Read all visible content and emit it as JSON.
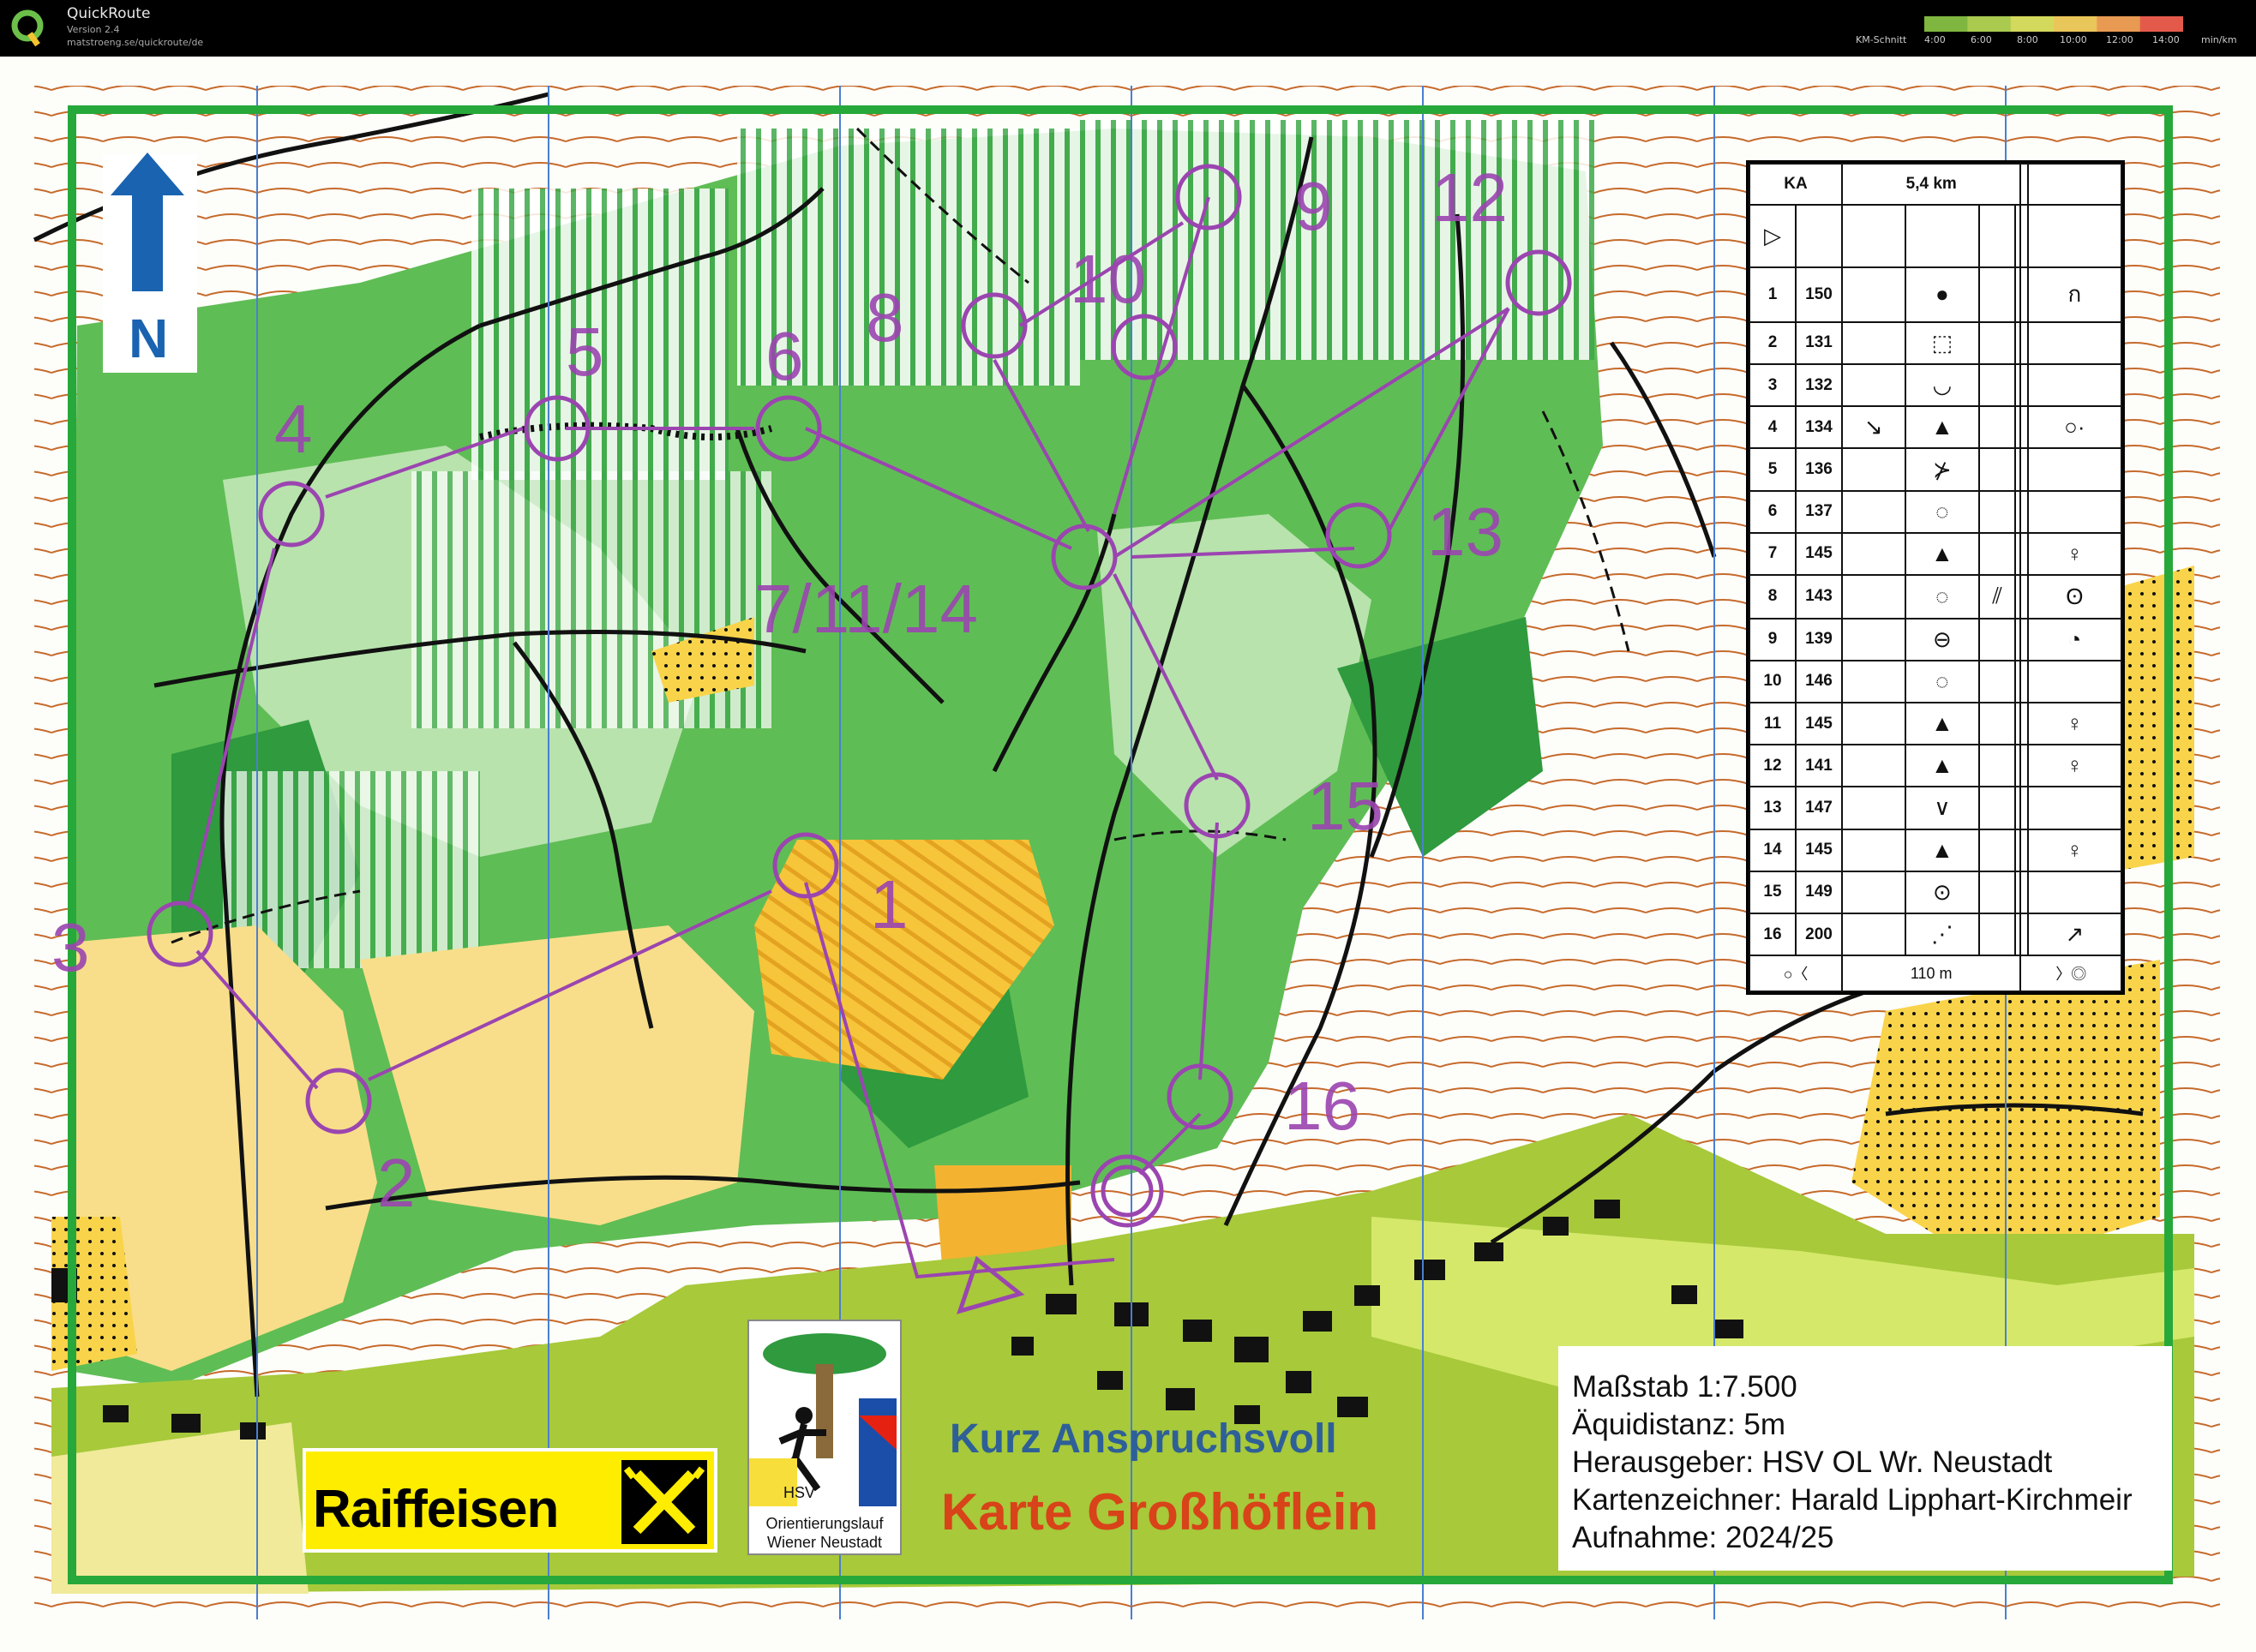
{
  "app": {
    "name": "QuickRoute",
    "version": "Version 2.4",
    "url": "matstroeng.se/quickroute/de"
  },
  "pace_scale": {
    "label": "KM-Schnitt",
    "ticks": [
      "4:00",
      "6:00",
      "8:00",
      "10:00",
      "12:00",
      "14:00"
    ],
    "unit": "min/km",
    "colors": [
      "#7fb640",
      "#a9c94f",
      "#d3d95c",
      "#e9c659",
      "#e99a52",
      "#e45a4a"
    ]
  },
  "map": {
    "north_label": "N",
    "course_color": "#9b45b0",
    "controls": [
      "1",
      "2",
      "3",
      "4",
      "5",
      "6",
      "7/11/14",
      "8",
      "9",
      "10",
      "12",
      "13",
      "15",
      "16"
    ],
    "course_name": "Kurz Anspruchsvoll",
    "map_name": "Karte Großhöflein"
  },
  "legend": {
    "header": [
      "KA",
      "5,4 km"
    ],
    "start_symbol": "▷",
    "rows": [
      {
        "n": "1",
        "code": "150",
        "c": "",
        "d": "●",
        "e": "",
        "g": "",
        "h": "ก"
      },
      {
        "n": "2",
        "code": "131",
        "c": "",
        "d": "⬚",
        "e": "",
        "g": "",
        "h": ""
      },
      {
        "n": "3",
        "code": "132",
        "c": "",
        "d": "◡",
        "e": "",
        "g": "",
        "h": ""
      },
      {
        "n": "4",
        "code": "134",
        "c": "↘",
        "d": "▲",
        "e": "",
        "g": "",
        "h": "○·"
      },
      {
        "n": "5",
        "code": "136",
        "c": "",
        "d": "⊁",
        "e": "",
        "g": "",
        "h": ""
      },
      {
        "n": "6",
        "code": "137",
        "c": "",
        "d": "◌",
        "e": "",
        "g": "",
        "h": ""
      },
      {
        "n": "7",
        "code": "145",
        "c": "",
        "d": "▲",
        "e": "",
        "g": "",
        "h": "♀"
      },
      {
        "n": "8",
        "code": "143",
        "c": "",
        "d": "◌",
        "e": "⫽",
        "g": "",
        "h": "ʘ"
      },
      {
        "n": "9",
        "code": "139",
        "c": "",
        "d": "⊖",
        "e": "",
        "g": "",
        "h": "◔"
      },
      {
        "n": "10",
        "code": "146",
        "c": "",
        "d": "◌",
        "e": "",
        "g": "",
        "h": ""
      },
      {
        "n": "11",
        "code": "145",
        "c": "",
        "d": "▲",
        "e": "",
        "g": "",
        "h": "♀"
      },
      {
        "n": "12",
        "code": "141",
        "c": "",
        "d": "▲",
        "e": "",
        "g": "",
        "h": "♀"
      },
      {
        "n": "13",
        "code": "147",
        "c": "",
        "d": "∨",
        "e": "",
        "g": "",
        "h": ""
      },
      {
        "n": "14",
        "code": "145",
        "c": "",
        "d": "▲",
        "e": "",
        "g": "",
        "h": "♀"
      },
      {
        "n": "15",
        "code": "149",
        "c": "",
        "d": "⊙",
        "e": "",
        "g": "",
        "h": ""
      },
      {
        "n": "16",
        "code": "200",
        "c": "",
        "d": "⋰",
        "e": "",
        "g": "",
        "h": "↗"
      }
    ],
    "finish_left": "○〈",
    "finish_distance": "110 m",
    "finish_right": "〉◎"
  },
  "info": {
    "scale": "Maßstab 1:7.500",
    "contour": "Äquidistanz: 5m",
    "publisher": "Herausgeber: HSV OL Wr. Neustadt",
    "cartographer": "Kartenzeichner: Harald Lipphart-Kirchmeir",
    "survey": "Aufnahme: 2024/25"
  },
  "sponsors": {
    "raiffeisen": "Raiffeisen",
    "club_badge": "HSV",
    "club_line1": "Orientierungslauf",
    "club_line2": "Wiener Neustadt"
  }
}
